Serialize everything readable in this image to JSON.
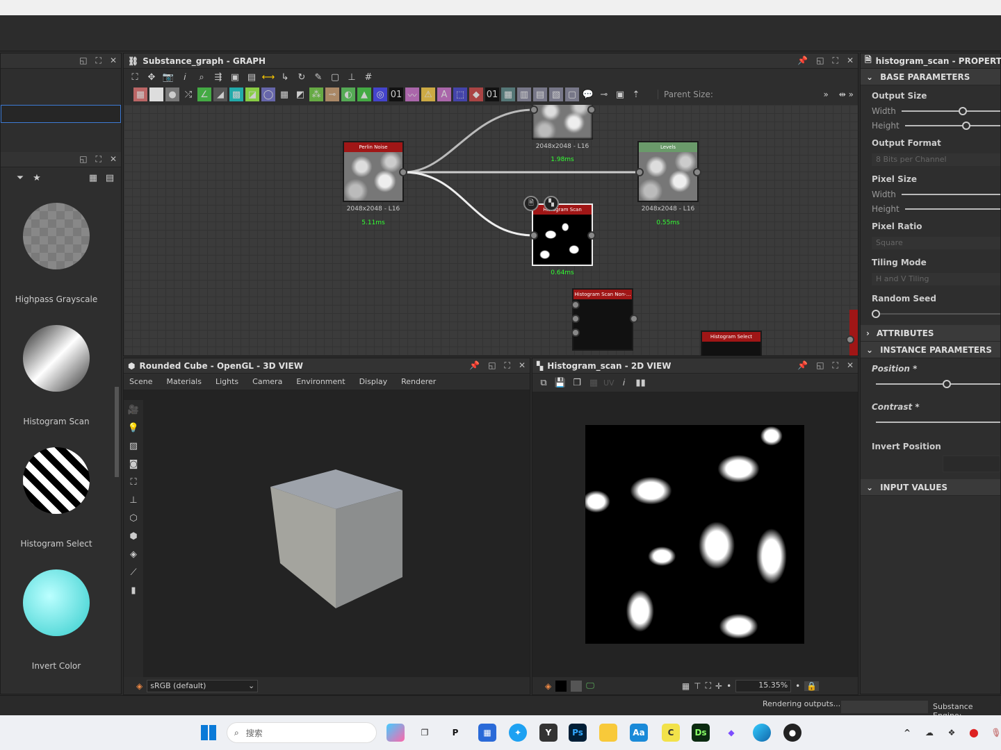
{
  "library": {
    "items": [
      {
        "label": "Highpass Grayscale"
      },
      {
        "label": "Histogram Scan"
      },
      {
        "label": "Histogram Select"
      },
      {
        "label": "Invert Color"
      }
    ]
  },
  "graph": {
    "title": "Substance_graph - GRAPH",
    "parent_size_label": "Parent Size:",
    "nodes": [
      {
        "title": "Perlin Noise",
        "res": "2048x2048 - L16",
        "time": "5.11ms"
      },
      {
        "title": "",
        "res": "2048x2048 - L16",
        "time": "1.98ms"
      },
      {
        "title": "Levels",
        "res": "2048x2048 - L16",
        "time": "0.55ms"
      },
      {
        "title": "Histogram Scan",
        "res": "",
        "time": "0.64ms"
      },
      {
        "title": "Histogram Scan Non-...",
        "res": "",
        "time": ""
      },
      {
        "title": "Histogram Select",
        "res": "",
        "time": ""
      }
    ]
  },
  "view3d": {
    "title": "Rounded Cube - OpenGL - 3D VIEW",
    "menu": [
      "Scene",
      "Materials",
      "Lights",
      "Camera",
      "Environment",
      "Display",
      "Renderer"
    ],
    "colorspace": "sRGB (default)"
  },
  "view2d": {
    "title": "Histogram_scan - 2D VIEW",
    "uv_label": "UV",
    "zoom": "15.35%"
  },
  "properties": {
    "title": "histogram_scan - PROPERTIES",
    "sections": {
      "base": "BASE PARAMETERS",
      "attributes": "ATTRIBUTES",
      "instance": "INSTANCE PARAMETERS",
      "input": "INPUT VALUES"
    },
    "output_size": "Output Size",
    "width": "Width",
    "height": "Height",
    "output_format": "Output Format",
    "output_format_value": "8 Bits per Channel",
    "pixel_size": "Pixel Size",
    "pixel_ratio": "Pixel Ratio",
    "pixel_ratio_value": "Square",
    "tiling_mode": "Tiling Mode",
    "tiling_mode_value": "H and V Tiling",
    "random_seed": "Random Seed",
    "position": "Position *",
    "contrast": "Contrast *",
    "invert_position": "Invert Position",
    "position_value": 0.5,
    "random_seed_value": 0
  },
  "status": {
    "rendering": "Rendering outputs...",
    "engine": "Substance Engine:"
  },
  "taskbar": {
    "search_placeholder": "搜索"
  }
}
